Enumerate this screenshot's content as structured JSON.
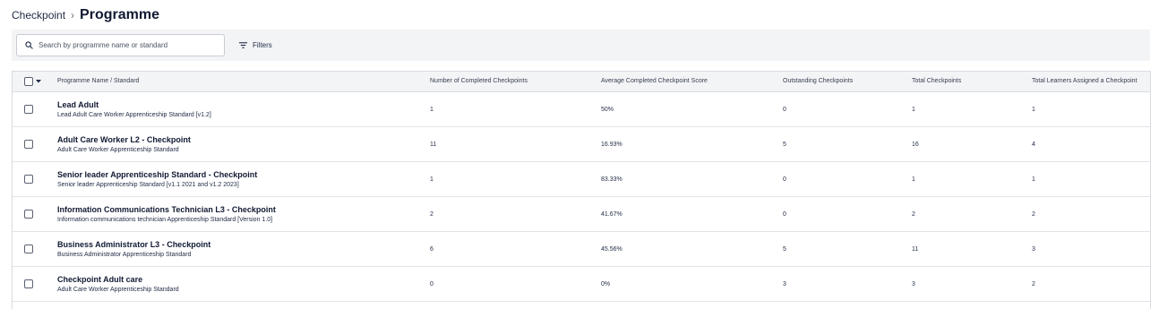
{
  "breadcrumb": {
    "parent": "Checkpoint",
    "separator": "›",
    "current": "Programme"
  },
  "toolbar": {
    "search_placeholder": "Search by programme name or standard",
    "search_value": "",
    "filters_label": "Filters"
  },
  "table": {
    "columns": [
      "Programme Name / Standard",
      "Number of Completed Checkpoints",
      "Average Completed Checkpoint Score",
      "Outstanding Checkpoints",
      "Total Checkpoints",
      "Total Learners Assigned a Checkpoint"
    ],
    "rows": [
      {
        "name": "Lead Adult",
        "standard": "Lead Adult Care Worker Apprenticeship Standard [v1.2]",
        "completed": "1",
        "avg_score": "50%",
        "outstanding": "0",
        "total": "1",
        "learners": "1"
      },
      {
        "name": "Adult Care Worker L2 - Checkpoint",
        "standard": "Adult Care Worker Apprenticeship Standard",
        "completed": "11",
        "avg_score": "16.93%",
        "outstanding": "5",
        "total": "16",
        "learners": "4"
      },
      {
        "name": "Senior leader Apprenticeship Standard - Checkpoint",
        "standard": "Senior leader Apprenticeship Standard [v1.1 2021 and v1.2 2023]",
        "completed": "1",
        "avg_score": "83.33%",
        "outstanding": "0",
        "total": "1",
        "learners": "1"
      },
      {
        "name": "Information Communications Technician L3 - Checkpoint",
        "standard": "Information communications technician Apprenticeship Standard [Version 1.0]",
        "completed": "2",
        "avg_score": "41.67%",
        "outstanding": "0",
        "total": "2",
        "learners": "2"
      },
      {
        "name": "Business Administrator L3 - Checkpoint",
        "standard": "Business Administrator Apprenticeship Standard",
        "completed": "6",
        "avg_score": "45.56%",
        "outstanding": "5",
        "total": "11",
        "learners": "3"
      },
      {
        "name": "Checkpoint Adult care",
        "standard": "Adult Care Worker Apprenticeship Standard",
        "completed": "0",
        "avg_score": "0%",
        "outstanding": "3",
        "total": "3",
        "learners": "2"
      }
    ]
  },
  "icons": {
    "search": "search-icon",
    "filters": "filter-lines-icon",
    "select_caret": "caret-down-icon"
  }
}
